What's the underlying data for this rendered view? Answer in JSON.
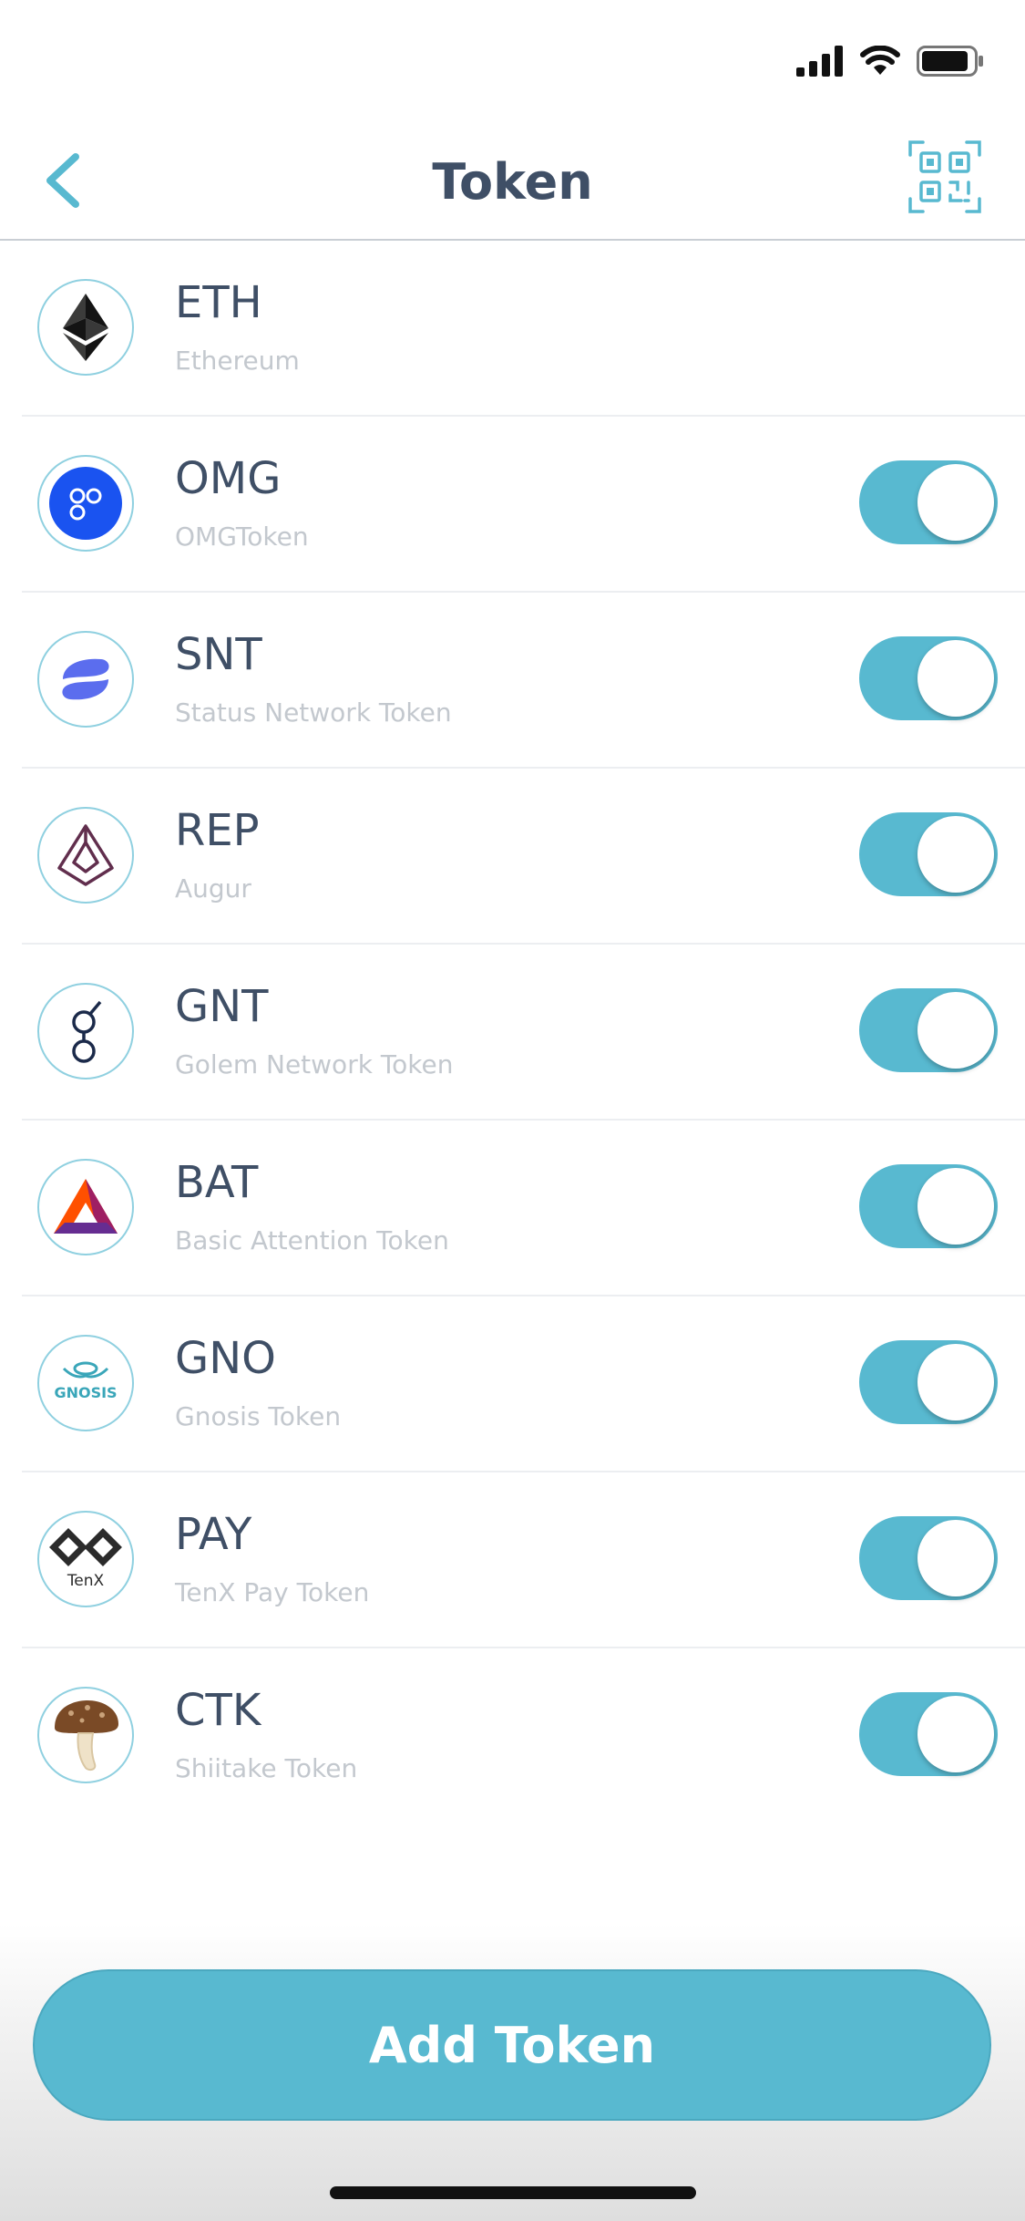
{
  "header": {
    "title": "Token"
  },
  "tokens": [
    {
      "symbol": "ETH",
      "name": "Ethereum",
      "logo": "ethereum-logo",
      "has_toggle": false
    },
    {
      "symbol": "OMG",
      "name": "OMGToken",
      "logo": "omg-logo",
      "has_toggle": true,
      "enabled": true
    },
    {
      "symbol": "SNT",
      "name": "Status Network Token",
      "logo": "status-logo",
      "has_toggle": true,
      "enabled": true
    },
    {
      "symbol": "REP",
      "name": "Augur",
      "logo": "augur-logo",
      "has_toggle": true,
      "enabled": true
    },
    {
      "symbol": "GNT",
      "name": "Golem Network Token",
      "logo": "golem-logo",
      "has_toggle": true,
      "enabled": true
    },
    {
      "symbol": "BAT",
      "name": "Basic Attention Token",
      "logo": "bat-logo",
      "has_toggle": true,
      "enabled": true
    },
    {
      "symbol": "GNO",
      "name": "Gnosis Token",
      "logo": "gnosis-logo",
      "logo_text": "GNOSIS",
      "has_toggle": true,
      "enabled": true
    },
    {
      "symbol": "PAY",
      "name": "TenX Pay Token",
      "logo": "tenx-logo",
      "logo_text": "TenX",
      "has_toggle": true,
      "enabled": true
    },
    {
      "symbol": "CTK",
      "name": "Shiitake Token",
      "logo": "shiitake-logo",
      "has_toggle": true,
      "enabled": true
    }
  ],
  "footer": {
    "add_button_label": "Add Token"
  },
  "colors": {
    "accent": "#58b9d0",
    "title_text": "#3f4f66",
    "subtitle_text": "#c3c8ce"
  }
}
